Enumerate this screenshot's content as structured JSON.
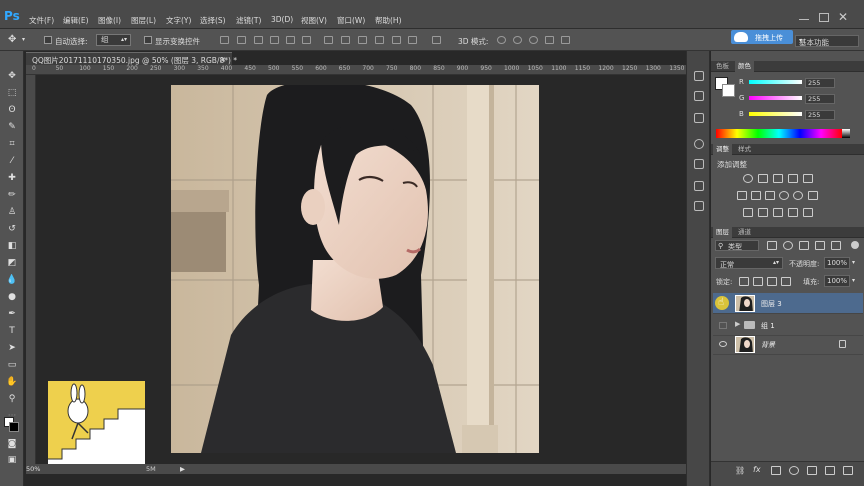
{
  "app": {
    "logo": "Ps"
  },
  "menu": [
    "文件(F)",
    "编辑(E)",
    "图像(I)",
    "图层(L)",
    "文字(Y)",
    "选择(S)",
    "滤镜(T)",
    "3D(D)",
    "视图(V)",
    "窗口(W)",
    "帮助(H)"
  ],
  "options": {
    "auto_select_label": "自动选择:",
    "auto_select_value": "组",
    "show_transform_label": "显示变换控件",
    "mode_3d_label": "3D 模式:",
    "upload_label": "拖拽上传",
    "workspace_label": "基本功能"
  },
  "document": {
    "tab_title": "QQ图片20171110170350.jpg @ 50% (图层 3, RGB/8*) *",
    "tab_close": "×",
    "zoom": "50%",
    "doc_size_fragment": "5M",
    "ruler_marks": [
      "0",
      "50",
      "100",
      "150",
      "200",
      "250",
      "300",
      "350",
      "400",
      "450",
      "500",
      "550",
      "600",
      "650",
      "700",
      "750",
      "800",
      "850",
      "900",
      "950",
      "1000",
      "1050",
      "1100",
      "1150",
      "1200",
      "1250",
      "1300",
      "1350"
    ]
  },
  "color_panel": {
    "tabs": [
      "色板",
      "颜色"
    ],
    "active_tab": 1,
    "channels": [
      {
        "label": "R",
        "value": "255",
        "color": "#ff3030"
      },
      {
        "label": "G",
        "value": "255",
        "color": "#30ff30"
      },
      {
        "label": "B",
        "value": "255",
        "color": "#3060ff"
      }
    ]
  },
  "adjust_panel": {
    "tabs": [
      "调整",
      "样式"
    ],
    "active_tab": 0,
    "title": "添加调整"
  },
  "layers_panel": {
    "tabs": [
      "图层",
      "通道"
    ],
    "active_tab": 0,
    "filter_kind": "类型",
    "blend_mode": "正常",
    "opacity_label": "不透明度:",
    "opacity_value": "100%",
    "lock_label": "锁定:",
    "fill_label": "填充:",
    "fill_value": "100%",
    "layers": [
      {
        "name": "图层 3",
        "selected": true,
        "visible": true
      },
      {
        "name": "组 1",
        "selected": false,
        "visible": false
      },
      {
        "name": "背景",
        "selected": false,
        "visible": true
      }
    ]
  },
  "colors": {
    "accent": "#31a8ff",
    "selection": "#4d6a8e",
    "sticker": "#eed04d"
  }
}
